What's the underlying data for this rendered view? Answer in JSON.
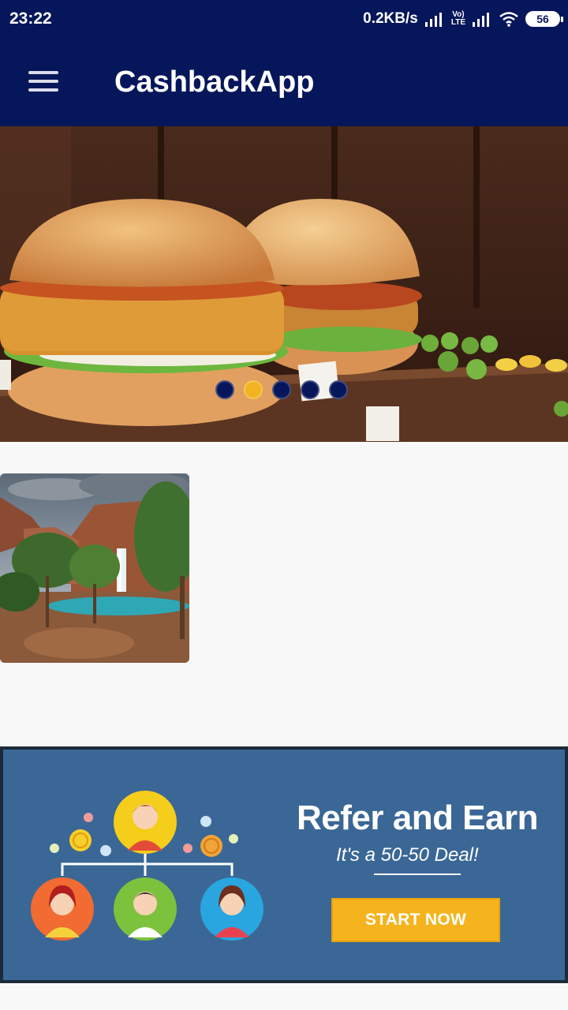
{
  "status_bar": {
    "time": "23:22",
    "net_speed": "0.2KB/s",
    "lte_top": "Vo)",
    "lte_bottom": "LTE",
    "battery": "56"
  },
  "app_bar": {
    "title": "CashbackApp",
    "menu_icon": "hamburger-menu-icon"
  },
  "banner": {
    "slides_total": 5,
    "active_slide": 2
  },
  "refer_card": {
    "title": "Refer and Earn",
    "subtitle": "It's a 50-50 Deal!",
    "button_label": "START NOW",
    "button_color": "#f5b41e"
  },
  "colors": {
    "primary": "#06165a",
    "accent": "#f2b320",
    "refer_bg": "#3a6796"
  }
}
